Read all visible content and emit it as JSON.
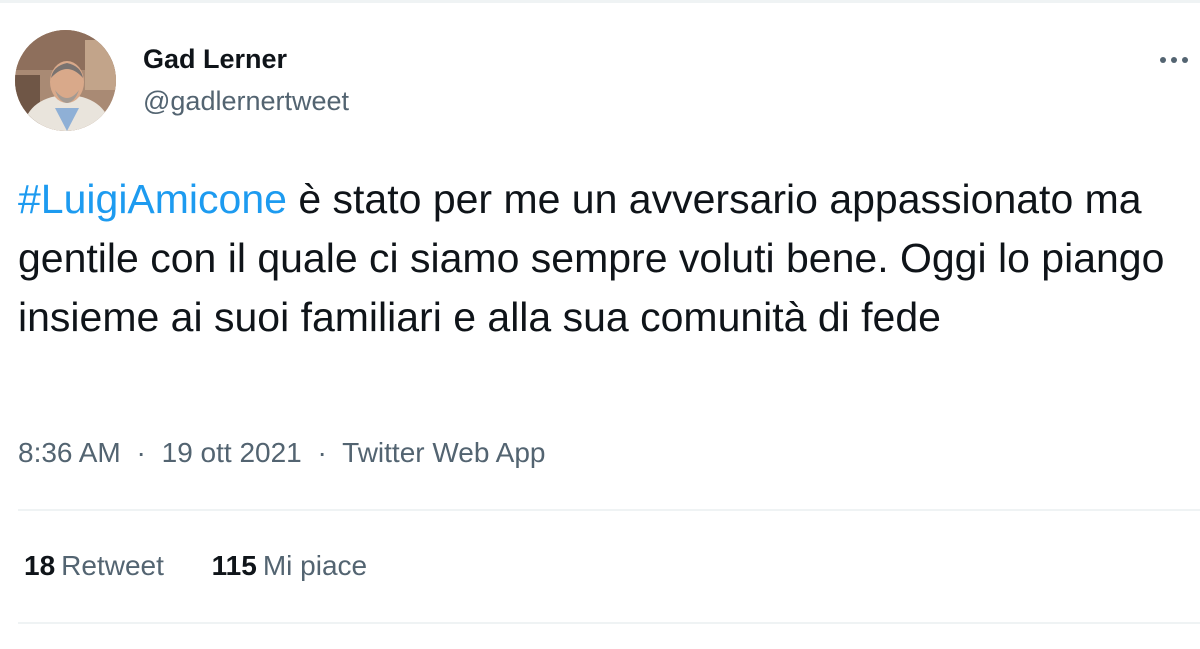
{
  "author": {
    "display_name": "Gad Lerner",
    "handle": "@gadlernertweet",
    "avatar_icon": "profile-photo"
  },
  "menu": {
    "icon": "more-horizontal-icon"
  },
  "tweet": {
    "hashtag": "#LuigiAmicone",
    "text": " è stato per me un avversario appassionato ma gentile con il quale ci siamo sempre voluti bene. Oggi lo piango insieme ai suoi familiari e alla sua comunità di fede"
  },
  "meta": {
    "time": "8:36 AM",
    "separator": "·",
    "date": "19 ott 2021",
    "source": "Twitter Web App"
  },
  "stats": {
    "retweets_count": "18",
    "retweets_label": "Retweet",
    "likes_count": "115",
    "likes_label": "Mi piace"
  },
  "colors": {
    "link": "#1d9bf0",
    "secondary_text": "#536471",
    "primary_text": "#0f1419",
    "divider": "#eff3f4"
  }
}
